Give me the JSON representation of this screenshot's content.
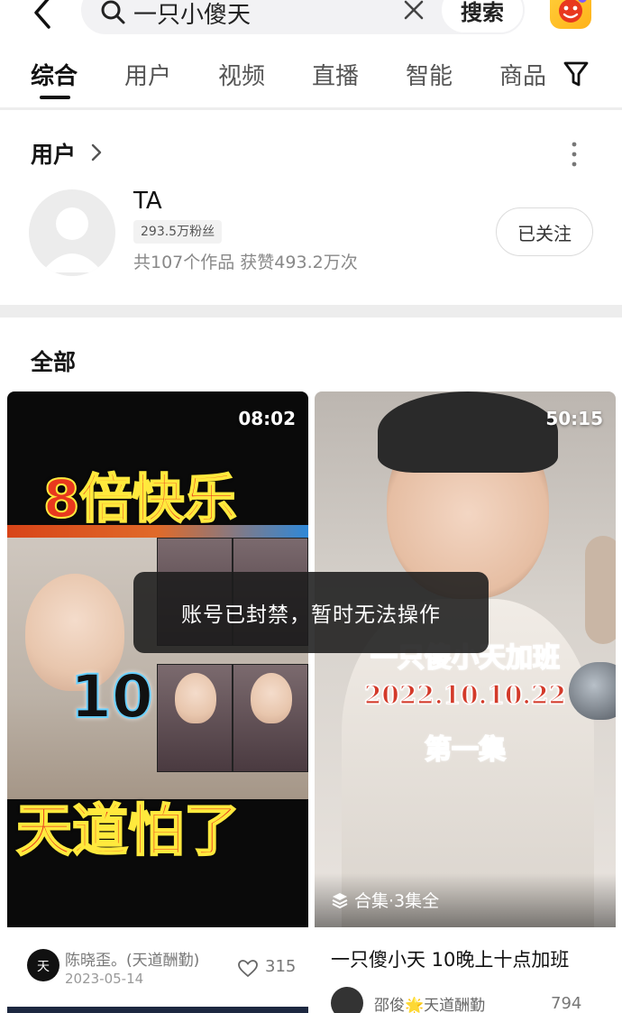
{
  "search": {
    "query": "一只小傻天",
    "button_label": "搜索"
  },
  "tabs": [
    {
      "label": "综合"
    },
    {
      "label": "用户"
    },
    {
      "label": "视频"
    },
    {
      "label": "直播"
    },
    {
      "label": "智能"
    },
    {
      "label": "商品"
    }
  ],
  "user_section": {
    "heading": "用户",
    "name": "TA",
    "fans": "293.5万粉丝",
    "stats": "共107个作品 获赞493.2万次",
    "follow_label": "已关注"
  },
  "all_section": {
    "heading": "全部"
  },
  "videos": [
    {
      "duration": "08:02",
      "cover_text_top": "8倍快乐",
      "cover_text_mid": "10",
      "cover_text_bottom": "天道怕了",
      "author": "陈晓歪。(天道酬勤)",
      "date": "2023-05-14",
      "likes": "315"
    },
    {
      "duration": "50:15",
      "cover_line1": "一只傻小天加班",
      "cover_line2": "2022.10.10.22",
      "cover_line3": "第一集",
      "collection": "合集·3集全",
      "title": "一只傻小天 10晚上十点加班",
      "author": "邵俊🌟天道酬勤",
      "likes": "794"
    }
  ],
  "toast": "账号已封禁，暂时无法操作",
  "colors": {
    "accent_red": "#e8381e",
    "toast_bg": "#1c1c1c"
  }
}
